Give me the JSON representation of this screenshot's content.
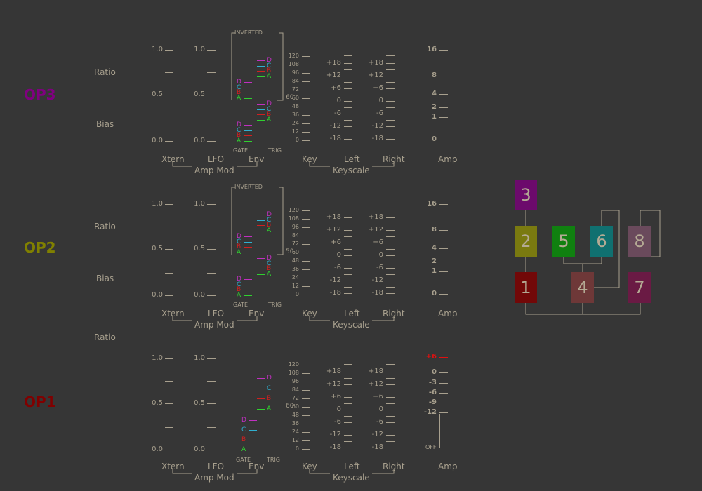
{
  "operators": [
    {
      "label": "OP3",
      "color": "#800080",
      "has_bias": true,
      "inverted": true,
      "ratio_mark": "60",
      "amp_mode": "pos"
    },
    {
      "label": "OP2",
      "color": "#808000",
      "has_bias": true,
      "inverted": true,
      "ratio_mark": "50",
      "amp_mode": "pos"
    },
    {
      "label": "OP1",
      "color": "#800000",
      "has_bias": false,
      "inverted": false,
      "ratio_mark": "60",
      "amp_mode": "out"
    }
  ],
  "row_labels": {
    "ratio": "Ratio",
    "bias": "Bias"
  },
  "col_labels": {
    "xtern": "Xtern",
    "lfo": "LFO",
    "env": "Env",
    "key": "Key",
    "left": "Left",
    "right": "Right",
    "amp": "Amp"
  },
  "group_labels": {
    "amp_mod": "Amp Mod",
    "keyscale": "Keyscale"
  },
  "mod_ticks": [
    "1.0",
    "0.5",
    "0.0"
  ],
  "env_labels": {
    "gate": "GATE",
    "trig": "TRIG",
    "inverted": "INVERTED"
  },
  "env_letters": [
    "D",
    "C",
    "B",
    "A"
  ],
  "env_colors": {
    "D": "#c030c0",
    "C": "#30b0d0",
    "B": "#d02020",
    "A": "#30d030"
  },
  "key_ticks": [
    "120",
    "108",
    "96",
    "84",
    "72",
    "60",
    "48",
    "36",
    "24",
    "12",
    "0"
  ],
  "scale_ticks": [
    "+18",
    "+12",
    "+6",
    "0",
    "-6",
    "-12",
    "-18"
  ],
  "amp_ticks_pos": [
    "16",
    "8",
    "4",
    "2",
    "1",
    "0"
  ],
  "amp_ticks_out": [
    "+6",
    "0",
    "-3",
    "-6",
    "-9",
    "-12"
  ],
  "amp_off": "OFF",
  "amp_hot_color": "#e01010",
  "algorithm": [
    {
      "num": "3",
      "color": "#6c0a6c"
    },
    {
      "num": "2",
      "color": "#7a7a10"
    },
    {
      "num": "5",
      "color": "#108010"
    },
    {
      "num": "6",
      "color": "#107070"
    },
    {
      "num": "8",
      "color": "#6a4a5c"
    },
    {
      "num": "1",
      "color": "#720808"
    },
    {
      "num": "4",
      "color": "#6e3838"
    },
    {
      "num": "7",
      "color": "#6a1a44"
    }
  ]
}
